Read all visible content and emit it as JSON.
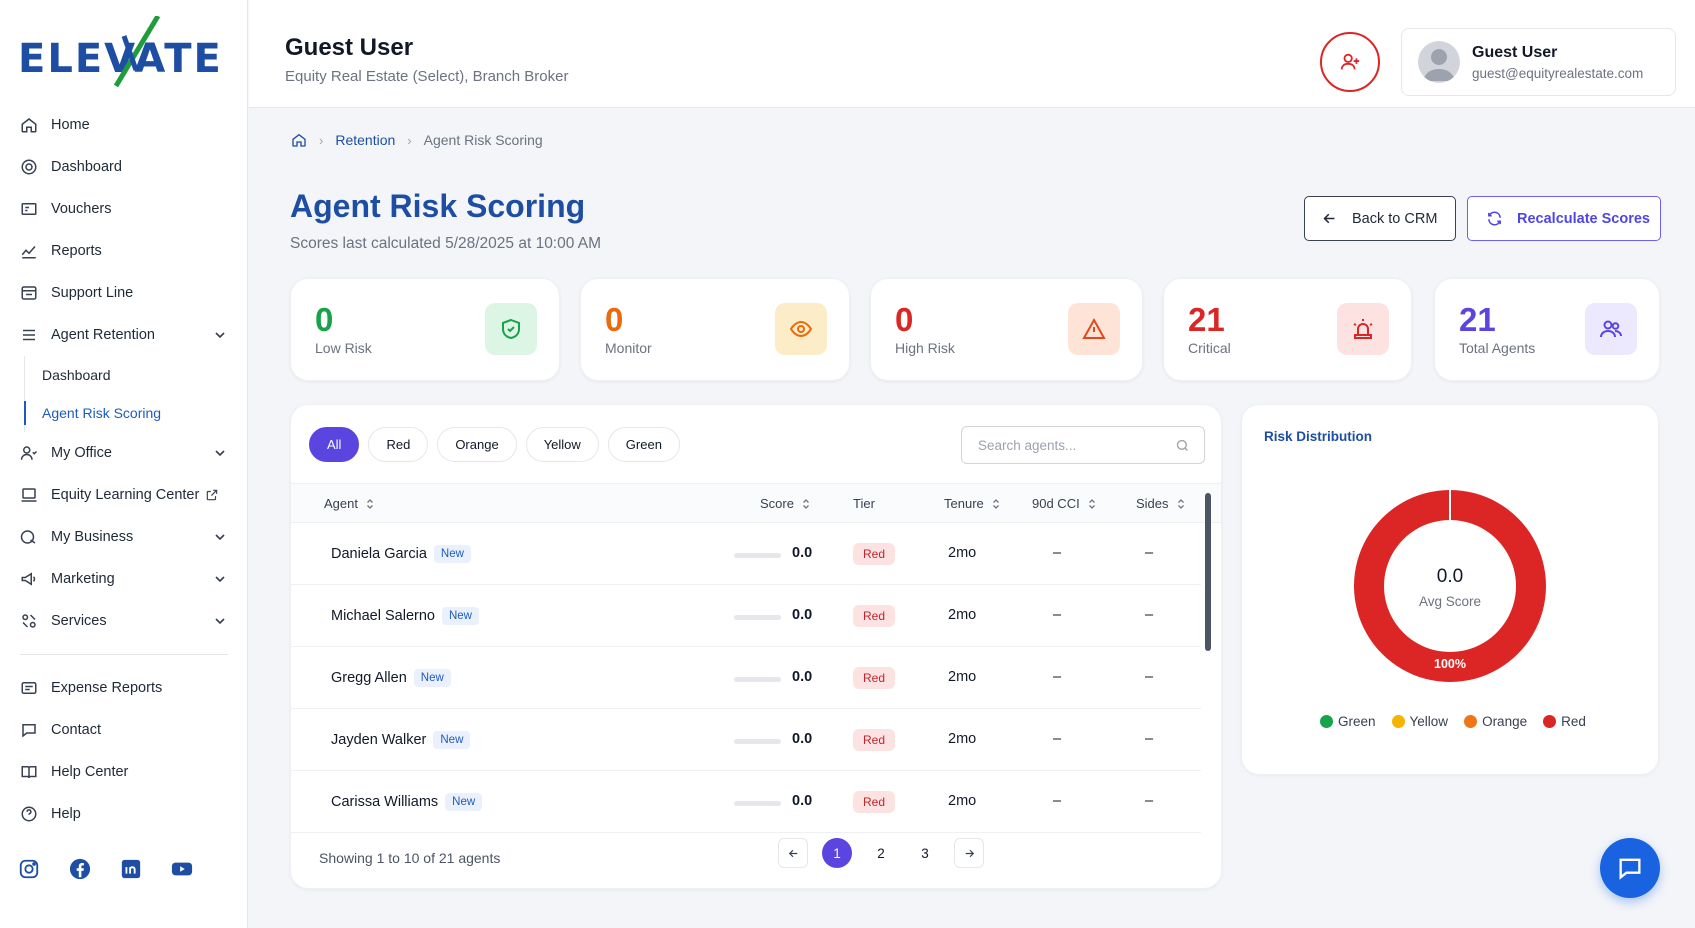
{
  "brand": {
    "logo_text": "ELEVATE",
    "logo_color": "#1e4ea3",
    "accent_slash": "#1f9d3a"
  },
  "sidebar": {
    "items": [
      {
        "label": "Home",
        "icon": "home-icon"
      },
      {
        "label": "Dashboard",
        "icon": "dashboard-icon"
      },
      {
        "label": "Vouchers",
        "icon": "voucher-icon"
      },
      {
        "label": "Reports",
        "icon": "reports-icon"
      },
      {
        "label": "Support Line",
        "icon": "support-icon"
      },
      {
        "label": "Agent Retention",
        "icon": "retention-icon",
        "expandable": true,
        "expanded": true
      },
      {
        "label": "My Office",
        "icon": "office-icon",
        "expandable": true
      },
      {
        "label": "Equity Learning Center",
        "icon": "learning-icon",
        "external": true
      },
      {
        "label": "My Business",
        "icon": "business-icon",
        "expandable": true
      },
      {
        "label": "Marketing",
        "icon": "megaphone-icon",
        "expandable": true
      },
      {
        "label": "Services",
        "icon": "services-icon",
        "expandable": true
      },
      {
        "label": "Expense Reports",
        "icon": "expense-icon"
      },
      {
        "label": "Contact",
        "icon": "chat-bubble-icon"
      },
      {
        "label": "Help Center",
        "icon": "book-icon"
      },
      {
        "label": "Help",
        "icon": "help-icon"
      }
    ],
    "retention_sub": [
      {
        "label": "Dashboard",
        "active": false
      },
      {
        "label": "Agent Risk Scoring",
        "active": true
      }
    ],
    "socials": [
      "instagram-icon",
      "facebook-icon",
      "linkedin-icon",
      "youtube-icon"
    ]
  },
  "header": {
    "user_name": "Guest User",
    "user_subtitle": "Equity Real Estate (Select), Branch Broker",
    "card_name": "Guest User",
    "card_email": "guest@equityrealestate.com"
  },
  "breadcrumb": {
    "section": "Retention",
    "current": "Agent Risk Scoring"
  },
  "page": {
    "title": "Agent Risk Scoring",
    "subtitle": "Scores last calculated 5/28/2025 at 10:00 AM",
    "back_label": "Back to CRM",
    "recalc_label": "Recalculate Scores"
  },
  "stats": [
    {
      "value": "0",
      "label": "Low Risk",
      "color": "#16a34a",
      "icon": "shield-check-icon"
    },
    {
      "value": "0",
      "label": "Monitor",
      "color": "#ea6a0c",
      "icon": "eye-icon"
    },
    {
      "value": "0",
      "label": "High Risk",
      "color": "#dc2626",
      "icon": "warning-icon"
    },
    {
      "value": "21",
      "label": "Critical",
      "color": "#dc2626",
      "icon": "siren-icon"
    },
    {
      "value": "21",
      "label": "Total Agents",
      "color": "#5b45e0",
      "icon": "users-icon"
    }
  ],
  "filters": {
    "pills": [
      "All",
      "Red",
      "Orange",
      "Yellow",
      "Green"
    ],
    "active": "All",
    "search_placeholder": "Search agents..."
  },
  "table": {
    "columns": {
      "agent": "Agent",
      "score": "Score",
      "tier": "Tier",
      "tenure": "Tenure",
      "cci": "90d CCI",
      "sides": "Sides"
    },
    "rows": [
      {
        "name": "Daniela Garcia",
        "badge": "New",
        "score": "0.0",
        "tier": "Red",
        "tenure": "2mo",
        "cci": "–",
        "sides": "–"
      },
      {
        "name": "Michael Salerno",
        "badge": "New",
        "score": "0.0",
        "tier": "Red",
        "tenure": "2mo",
        "cci": "–",
        "sides": "–"
      },
      {
        "name": "Gregg Allen",
        "badge": "New",
        "score": "0.0",
        "tier": "Red",
        "tenure": "2mo",
        "cci": "–",
        "sides": "–"
      },
      {
        "name": "Jayden Walker",
        "badge": "New",
        "score": "0.0",
        "tier": "Red",
        "tenure": "2mo",
        "cci": "–",
        "sides": "–"
      },
      {
        "name": "Carissa Williams",
        "badge": "New",
        "score": "0.0",
        "tier": "Red",
        "tenure": "2mo",
        "cci": "–",
        "sides": "–"
      }
    ],
    "footer": "Showing 1 to 10 of 21 agents",
    "pages": [
      "1",
      "2",
      "3"
    ],
    "current_page": "1"
  },
  "distribution": {
    "title": "Risk Distribution",
    "avg_score": "0.0",
    "avg_label": "Avg Score",
    "red_percent_label": "100%",
    "legend": [
      {
        "label": "Green",
        "color": "#16a34a"
      },
      {
        "label": "Yellow",
        "color": "#f5b400"
      },
      {
        "label": "Orange",
        "color": "#f07516"
      },
      {
        "label": "Red",
        "color": "#dc2626"
      }
    ]
  },
  "chart_data": {
    "type": "pie",
    "title": "Risk Distribution",
    "categories": [
      "Green",
      "Yellow",
      "Orange",
      "Red"
    ],
    "values": [
      0,
      0,
      0,
      100
    ]
  }
}
